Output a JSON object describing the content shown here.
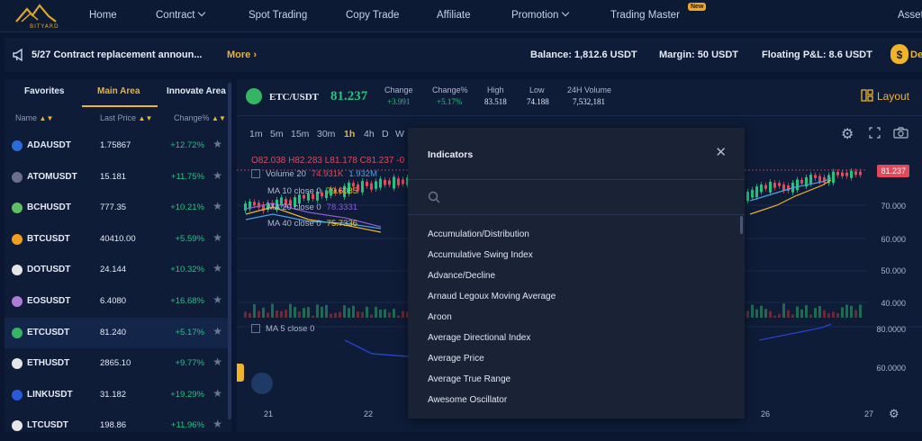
{
  "brand": {
    "logo_text": "BITYARD"
  },
  "nav": {
    "home": "Home",
    "contract": "Contract",
    "spot": "Spot Trading",
    "copy": "Copy Trade",
    "affiliate": "Affiliate",
    "promotion": "Promotion",
    "master": "Trading Master",
    "new_badge": "New",
    "assets": "Asset"
  },
  "infobar": {
    "announcement": "5/27 Contract replacement announ...",
    "more": "More",
    "balance": "Balance: 1,812.6 USDT",
    "margin": "Margin: 50 USDT",
    "pnl": "Floating P&L: 8.6 USDT",
    "deposit_cut": "De"
  },
  "market": {
    "tabs": [
      "Favorites",
      "Main Area",
      "Innovate Area"
    ],
    "headers": {
      "name": "Name",
      "price": "Last Price",
      "change": "Change%"
    },
    "rows": [
      {
        "sym": "ADAUSDT",
        "price": "1.75867",
        "chg": "+12.72%",
        "color": "#2a6ad9"
      },
      {
        "sym": "ATOMUSDT",
        "price": "15.181",
        "chg": "+11.75%",
        "color": "#6b6f8c"
      },
      {
        "sym": "BCHUSDT",
        "price": "777.35",
        "chg": "+10.21%",
        "color": "#5fbf63"
      },
      {
        "sym": "BTCUSDT",
        "price": "40410.00",
        "chg": "+5.59%",
        "color": "#f2a01c"
      },
      {
        "sym": "DOTUSDT",
        "price": "24.144",
        "chg": "+10.32%",
        "color": "#e6e6e6"
      },
      {
        "sym": "EOSUSDT",
        "price": "6.4080",
        "chg": "+16.68%",
        "color": "#b07ad9"
      },
      {
        "sym": "ETCUSDT",
        "price": "81.240",
        "chg": "+5.17%",
        "color": "#34b564"
      },
      {
        "sym": "ETHUSDT",
        "price": "2865.10",
        "chg": "+9.77%",
        "color": "#e6e6e6"
      },
      {
        "sym": "LINKUSDT",
        "price": "31.182",
        "chg": "+19.29%",
        "color": "#2a5ada"
      },
      {
        "sym": "LTCUSDT",
        "price": "198.86",
        "chg": "+11.96%",
        "color": "#e6e6e6"
      }
    ]
  },
  "ticker": {
    "symbol": "ETC/USDT",
    "price": "81.237",
    "labels": [
      "Change",
      "Change%",
      "High",
      "Low",
      "24H Volume"
    ],
    "values": [
      "+3.991",
      "+5.17%",
      "83.518",
      "74.188",
      "7,532,181"
    ],
    "layout": "Layout"
  },
  "chart": {
    "timeframes": [
      "1m",
      "5m",
      "15m",
      "30m",
      "1h",
      "4h",
      "D",
      "W"
    ],
    "ohlc": "O82.038 H82.283 L81.178 C81.237 -0",
    "volume_label": "Volume 20",
    "volume_v1": "74.931K",
    "volume_v2": "1.932M",
    "ma10_label": "MA 10 close 0",
    "ma10_val": "79.6085",
    "ma20_label": "MA 20 close 0",
    "ma20_val": "78.3331",
    "ma40_label": "MA 40 close 0",
    "ma40_val": "75.7336",
    "ma5_label": "MA 5 close 0",
    "last_price_tag": "81.237",
    "y_ticks": [
      "70.000",
      "60.000",
      "50.000",
      "40.000",
      "80.0000",
      "60.0000"
    ],
    "x_ticks": [
      "21",
      "22",
      "26",
      "27"
    ]
  },
  "indicators_modal": {
    "title": "Indicators",
    "items": [
      "Accumulation/Distribution",
      "Accumulative Swing Index",
      "Advance/Decline",
      "Arnaud Legoux Moving Average",
      "Aroon",
      "Average Directional Index",
      "Average Price",
      "Average True Range",
      "Awesome Oscillator"
    ]
  },
  "colors": {
    "accent": "#f0b429",
    "up": "#26c281",
    "down": "#e04a5a",
    "bg": "#0b1730"
  }
}
